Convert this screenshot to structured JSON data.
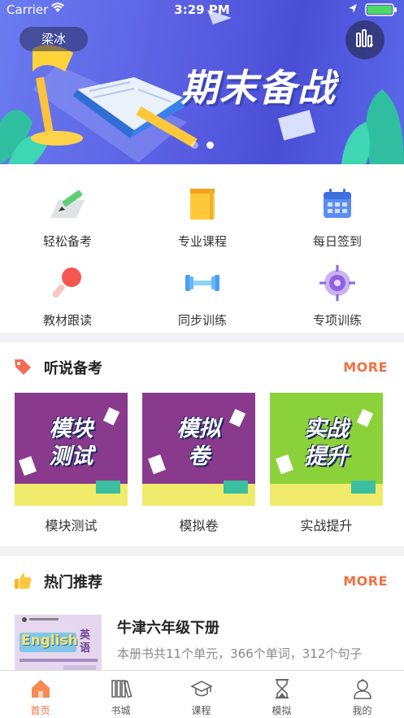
{
  "status_bar": {
    "carrier": "Carrier",
    "time": "3:29 PM"
  },
  "header": {
    "user_name": "梁冰"
  },
  "banner": {
    "title": "期末备战",
    "slides": 2,
    "active_slide": 1
  },
  "quick_grid": [
    {
      "label": "轻松备考",
      "icon": "pencil-paper-icon"
    },
    {
      "label": "专业课程",
      "icon": "book-icon"
    },
    {
      "label": "每日签到",
      "icon": "calendar-icon"
    },
    {
      "label": "教材跟读",
      "icon": "microphone-icon"
    },
    {
      "label": "同步训练",
      "icon": "dumbbell-icon"
    },
    {
      "label": "专项训练",
      "icon": "target-icon"
    }
  ],
  "listening_section": {
    "title": "听说备考",
    "more": "MORE",
    "cards": [
      {
        "cover_line1": "模块",
        "cover_line2": "测试",
        "label": "模块测试"
      },
      {
        "cover_line1": "模拟",
        "cover_line2": "卷",
        "label": "模拟卷"
      },
      {
        "cover_line1": "实战",
        "cover_line2": "提升",
        "label": "实战提升"
      }
    ],
    "colors": {
      "purple": "#8a3a8c",
      "green": "#8bd23a",
      "yellow": "#f0ea6a"
    }
  },
  "hot_section": {
    "title": "热门推荐",
    "more": "MORE",
    "item": {
      "title": "牛津六年级下册",
      "desc": "本册书共11个单元，366个单词，312个句子",
      "cover_text_en": "English",
      "cover_text_cn": "英语"
    }
  },
  "tabbar": [
    {
      "label": "首页",
      "icon": "home-icon",
      "active": true
    },
    {
      "label": "书城",
      "icon": "bookshelf-icon",
      "active": false
    },
    {
      "label": "课程",
      "icon": "graduation-cap-icon",
      "active": false
    },
    {
      "label": "模拟",
      "icon": "hourglass-icon",
      "active": false
    },
    {
      "label": "我的",
      "icon": "profile-icon",
      "active": false
    }
  ],
  "accent_color": "#f06a3f"
}
